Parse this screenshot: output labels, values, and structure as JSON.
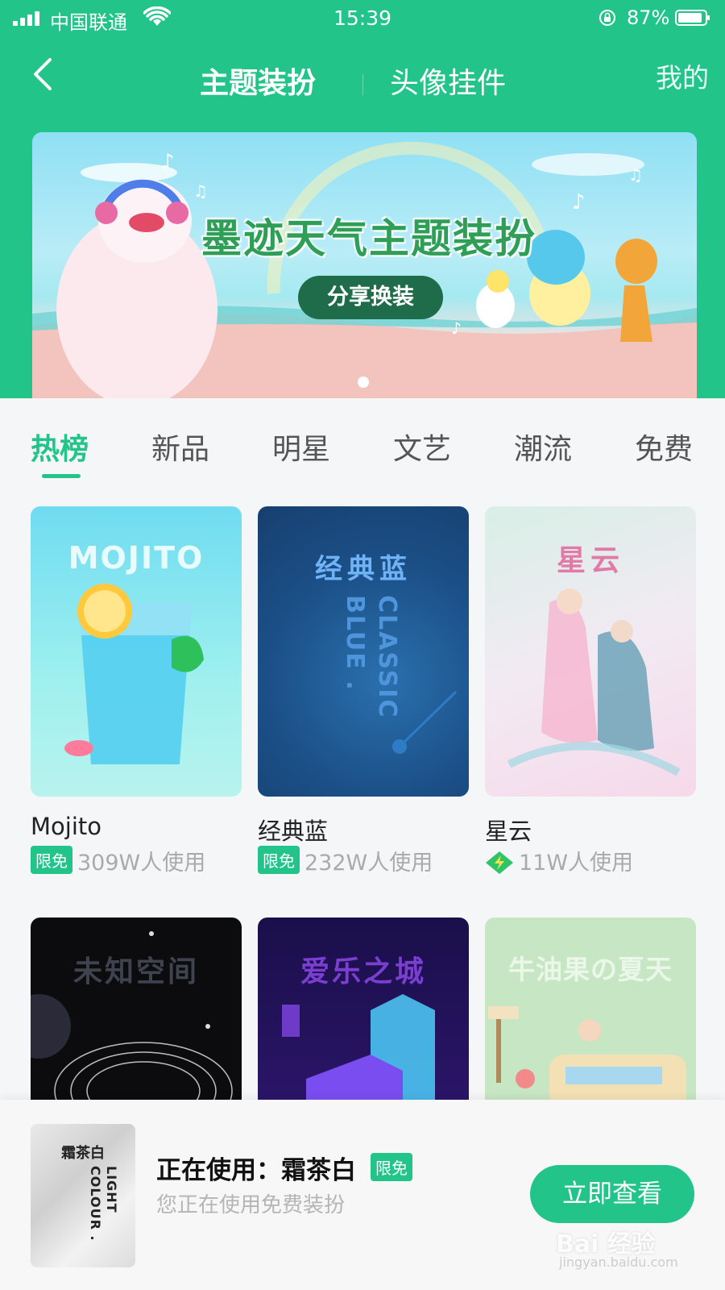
{
  "status_bar": {
    "carrier": "中国联通",
    "time": "15:39",
    "battery": "87%"
  },
  "header": {
    "tabs": [
      {
        "label": "主题装扮",
        "active": true
      },
      {
        "label": "头像挂件",
        "active": false
      }
    ],
    "mine": "我的"
  },
  "banner": {
    "title": "墨迹天气主题装扮",
    "cta": "分享换装",
    "current_slide": 1,
    "slide_count": 1
  },
  "category_tabs": [
    {
      "label": "热榜",
      "active": true
    },
    {
      "label": "新品",
      "active": false
    },
    {
      "label": "明星",
      "active": false
    },
    {
      "label": "文艺",
      "active": false
    },
    {
      "label": "潮流",
      "active": false
    },
    {
      "label": "免费",
      "active": false
    }
  ],
  "themes": [
    {
      "name": "Mojito",
      "thumb_title": "MOJITO",
      "badge": "限免",
      "usage": "309W人使用"
    },
    {
      "name": "经典蓝",
      "thumb_title": "经典蓝",
      "thumb_subtitle": "CLASSIC BLUE .",
      "badge": "限免",
      "usage": "232W人使用"
    },
    {
      "name": "星云",
      "thumb_title": "星云",
      "badge_icon": "lightning-diamond-icon",
      "usage": "11W人使用"
    },
    {
      "thumb_title": "未知空间"
    },
    {
      "thumb_title": "爱乐之城"
    },
    {
      "thumb_title": "牛油果の夏天"
    }
  ],
  "current": {
    "label": "正在使用：霜茶白",
    "badge": "限免",
    "subtitle": "您正在使用免费装扮",
    "thumb_title": "霜茶白",
    "thumb_subtitle": "LIGHT COLOUR .",
    "button": "立即查看"
  },
  "watermark": {
    "text": "Bai 经验",
    "sub": "jingyan.baidu.com"
  },
  "colors": {
    "accent": "#22c489",
    "badge": "#22c489"
  }
}
